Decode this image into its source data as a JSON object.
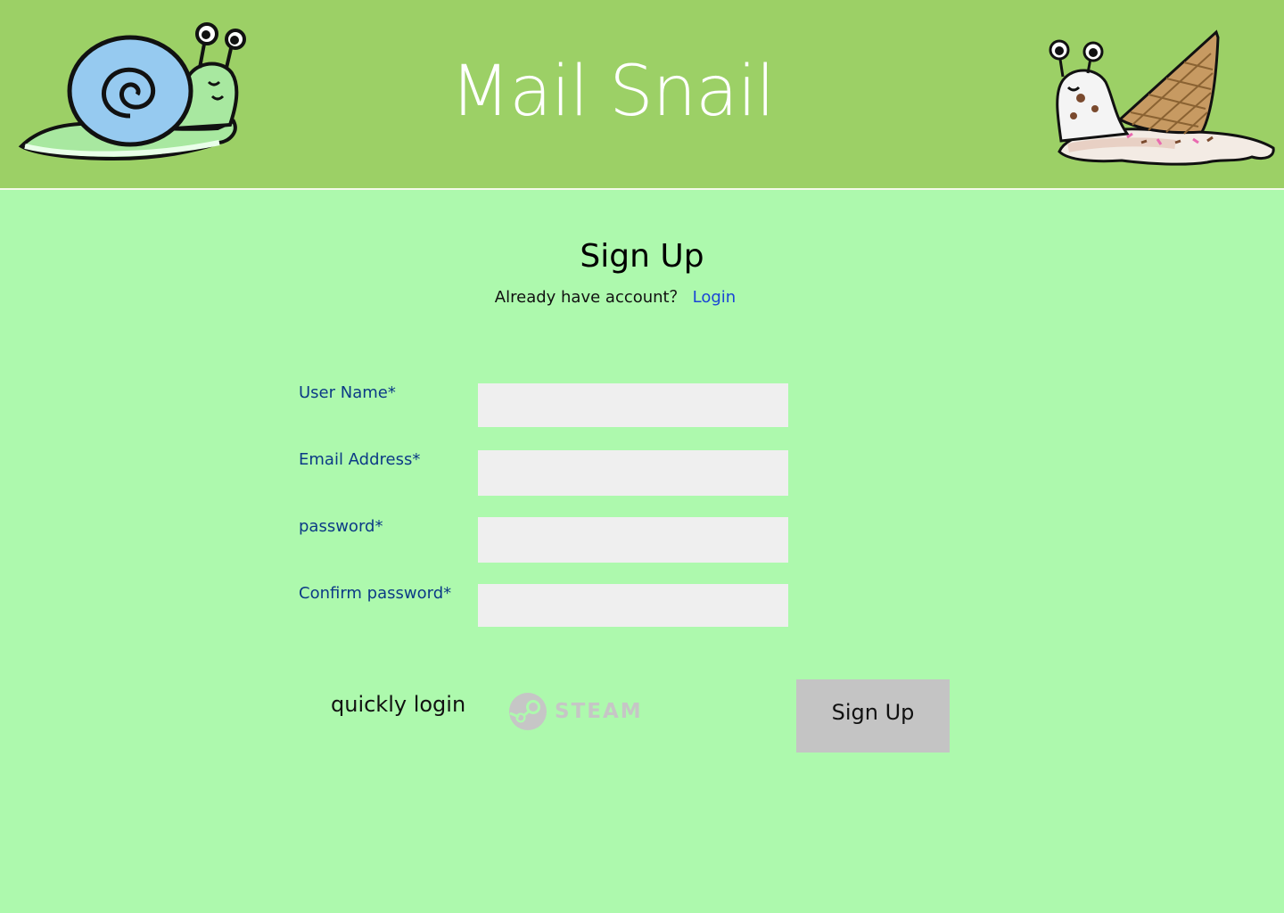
{
  "header": {
    "brand_title": "Mail Snail",
    "left_logo_icon": "snail-icon",
    "right_logo_icon": "ice-cream-snail-icon"
  },
  "signup": {
    "title": "Sign Up",
    "account_prompt": "Already have account？",
    "login_link": "Login",
    "fields": [
      {
        "label": "User Name*",
        "value": ""
      },
      {
        "label": "Email Address*",
        "value": ""
      },
      {
        "label": "password*",
        "value": ""
      },
      {
        "label": "Confirm password*",
        "value": ""
      }
    ],
    "quick_login_label": "quickly login",
    "steam_label": "STEAM",
    "steam_icon": "steam-icon",
    "submit_label": "Sign Up"
  },
  "colors": {
    "header_bg": "#9cd066",
    "page_bg": "#adf9ad",
    "label_color": "#0c3a86",
    "link_color": "#1a44d6",
    "input_bg": "#efefef",
    "button_bg": "#c4c4c4"
  }
}
